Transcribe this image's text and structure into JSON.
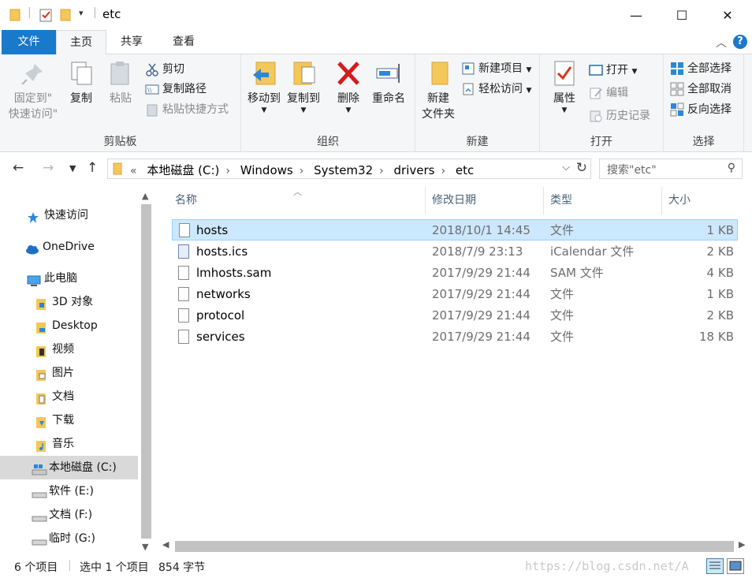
{
  "window": {
    "title": "etc",
    "minimize": "—",
    "maximize": "☐",
    "close": "✕"
  },
  "ribbon_tabs": [
    {
      "label": "文件"
    },
    {
      "label": "主页"
    },
    {
      "label": "共享"
    },
    {
      "label": "查看"
    }
  ],
  "help_label": "?",
  "ribbon": {
    "clipboard": {
      "group_label": "剪贴板",
      "pin_label_1": "固定到\"",
      "pin_label_2": "快速访问\"",
      "copy": "复制",
      "paste": "粘贴",
      "cut": "剪切",
      "copy_path": "复制路径",
      "paste_shortcut": "粘贴快捷方式"
    },
    "organize": {
      "group_label": "组织",
      "move_to": "移动到",
      "copy_to": "复制到",
      "delete": "删除",
      "rename": "重命名"
    },
    "new": {
      "group_label": "新建",
      "new_folder_1": "新建",
      "new_folder_2": "文件夹",
      "new_item": "新建项目",
      "easy_access": "轻松访问"
    },
    "open": {
      "group_label": "打开",
      "properties": "属性",
      "open": "打开",
      "edit": "编辑",
      "history": "历史记录"
    },
    "select": {
      "group_label": "选择",
      "select_all": "全部选择",
      "select_none": "全部取消",
      "invert": "反向选择"
    }
  },
  "address": {
    "breadcrumbs": [
      "本地磁盘 (C:)",
      "Windows",
      "System32",
      "drivers",
      "etc"
    ],
    "overflow": "«",
    "search_placeholder": "搜索\"etc\""
  },
  "nav_pane": {
    "items": [
      {
        "label": "快速访问",
        "icon": "star-icon"
      },
      {
        "label": "OneDrive",
        "icon": "cloud-icon"
      },
      {
        "label": "此电脑",
        "icon": "computer-icon"
      },
      {
        "label": "3D 对象",
        "icon": "folder-icon"
      },
      {
        "label": "Desktop",
        "icon": "folder-icon"
      },
      {
        "label": "视频",
        "icon": "folder-icon"
      },
      {
        "label": "图片",
        "icon": "folder-icon"
      },
      {
        "label": "文档",
        "icon": "folder-icon"
      },
      {
        "label": "下载",
        "icon": "folder-icon"
      },
      {
        "label": "音乐",
        "icon": "folder-icon"
      },
      {
        "label": "本地磁盘 (C:)",
        "icon": "drive-icon"
      },
      {
        "label": "软件 (E:)",
        "icon": "drive-icon"
      },
      {
        "label": "文档 (F:)",
        "icon": "drive-icon"
      },
      {
        "label": "临时 (G:)",
        "icon": "drive-icon"
      }
    ]
  },
  "file_list": {
    "columns": [
      "名称",
      "修改日期",
      "类型",
      "大小"
    ],
    "rows": [
      {
        "name": "hosts",
        "date": "2018/10/1 14:45",
        "type": "文件",
        "size": "1 KB"
      },
      {
        "name": "hosts.ics",
        "date": "2018/7/9 23:13",
        "type": "iCalendar 文件",
        "size": "2 KB"
      },
      {
        "name": "lmhosts.sam",
        "date": "2017/9/29 21:44",
        "type": "SAM 文件",
        "size": "4 KB"
      },
      {
        "name": "networks",
        "date": "2017/9/29 21:44",
        "type": "文件",
        "size": "1 KB"
      },
      {
        "name": "protocol",
        "date": "2017/9/29 21:44",
        "type": "文件",
        "size": "2 KB"
      },
      {
        "name": "services",
        "date": "2017/9/29 21:44",
        "type": "文件",
        "size": "18 KB"
      }
    ]
  },
  "status": {
    "item_count": "6 个项目",
    "selection": "选中 1 个项目",
    "selection_size": "854 字节",
    "watermark": "https://blog.csdn.net/A"
  },
  "colors": {
    "accent": "#1979ca",
    "selection": "#cce8ff"
  }
}
